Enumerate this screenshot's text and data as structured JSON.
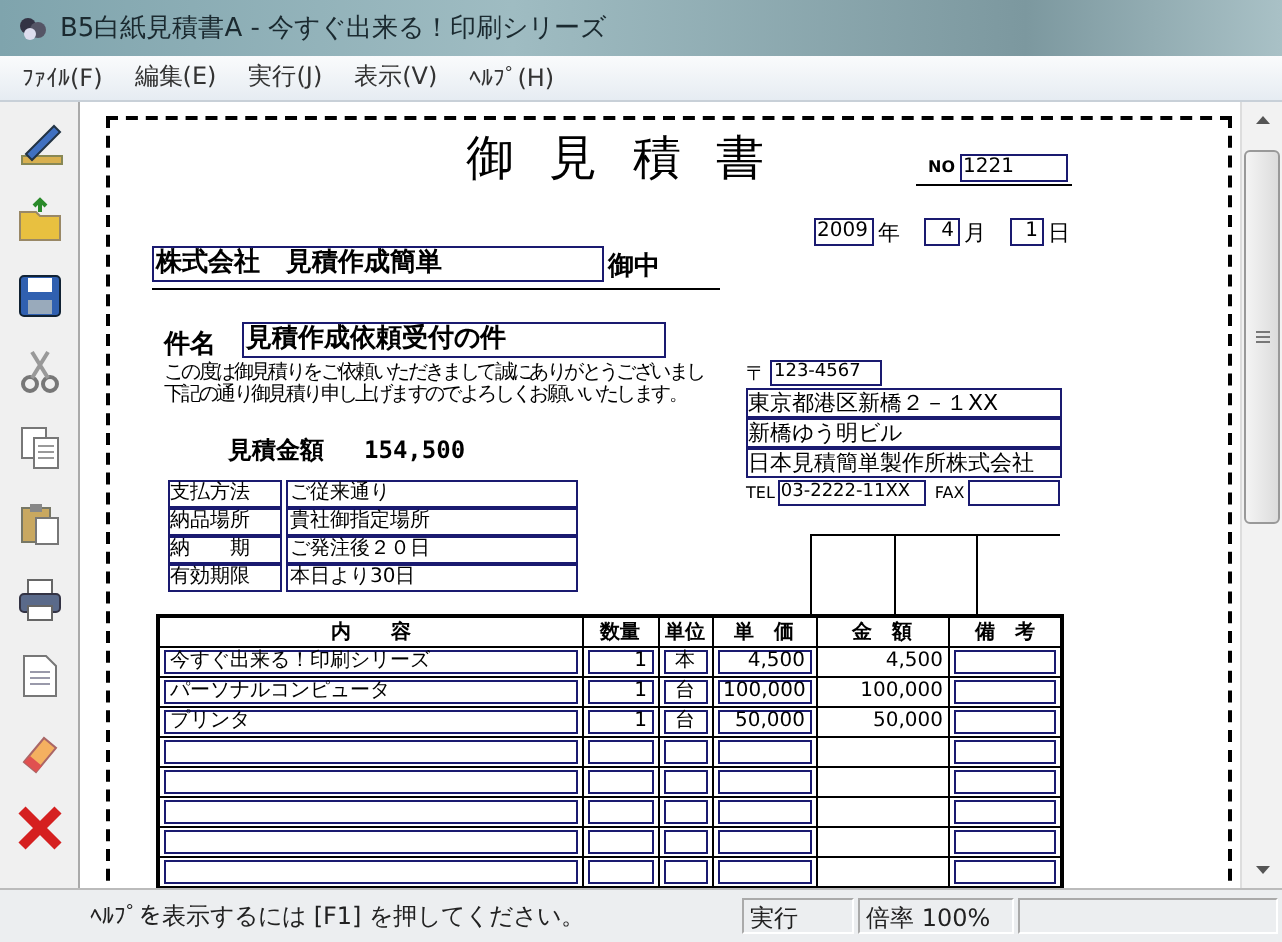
{
  "window": {
    "title": "B5白紙見積書A - 今すぐ出来る！印刷シリーズ"
  },
  "menu": [
    "ﾌｧｲﾙ(F)",
    "編集(E)",
    "実行(J)",
    "表示(V)",
    "ﾍﾙﾌﾟ(H)"
  ],
  "document": {
    "title": "御 見 積 書",
    "number_label": "NO",
    "number": "1221",
    "date": {
      "year": "2009",
      "year_unit": "年",
      "month": "4",
      "month_unit": "月",
      "day": "1",
      "day_unit": "日"
    },
    "recipient": "株式会社　見積作成簡単",
    "recipient_suffix": "御中",
    "subject_label": "件名",
    "subject": "見積作成依頼受付の件",
    "greeting": [
      "この度は御見積りをご依頼いただきまして誠にありがとうございまし",
      "下記の通り御見積り申し上げますのでよろしくお願いいたします。"
    ],
    "total_label": "見積金額",
    "total": "154,500",
    "terms": [
      {
        "label": "支払方法",
        "value": "ご従来通り"
      },
      {
        "label": "納品場所",
        "value": "貴社御指定場所"
      },
      {
        "label": "納　　期",
        "value": "ご発注後２０日"
      },
      {
        "label": "有効期限",
        "value": "本日より30日"
      }
    ],
    "postal_mark": "〒",
    "postal_code": "123-4567",
    "address": [
      "東京都港区新橋２－１XX",
      "新橋ゆう明ビル",
      "日本見積簡単製作所株式会社"
    ],
    "tel_label": "TEL",
    "tel": "03-2222-11XX",
    "fax_label": "FAX",
    "table": {
      "columns": [
        "内　　容",
        "数量",
        "単位",
        "単　価",
        "金　額",
        "備　考"
      ],
      "rows": [
        {
          "kind": "item",
          "content": "今すぐ出来る！印刷シリーズ",
          "quantity": "1",
          "unit": "本",
          "price": "4,500",
          "amount": "4,500"
        },
        {
          "kind": "item",
          "content": "パーソナルコンピュータ",
          "quantity": "1",
          "unit": "台",
          "price": "100,000",
          "amount": "100,000"
        },
        {
          "kind": "item",
          "content": "プリンタ",
          "quantity": "1",
          "unit": "台",
          "price": "50,000",
          "amount": "50,000"
        },
        {
          "kind": "blank"
        },
        {
          "kind": "blank"
        },
        {
          "kind": "blank"
        },
        {
          "kind": "blank"
        },
        {
          "kind": "blank"
        }
      ]
    }
  },
  "status_bar": {
    "message": "ﾍﾙﾌﾟを表示するには [F1] を押してください。",
    "mode": "実行",
    "zoom": "倍率 100%"
  }
}
